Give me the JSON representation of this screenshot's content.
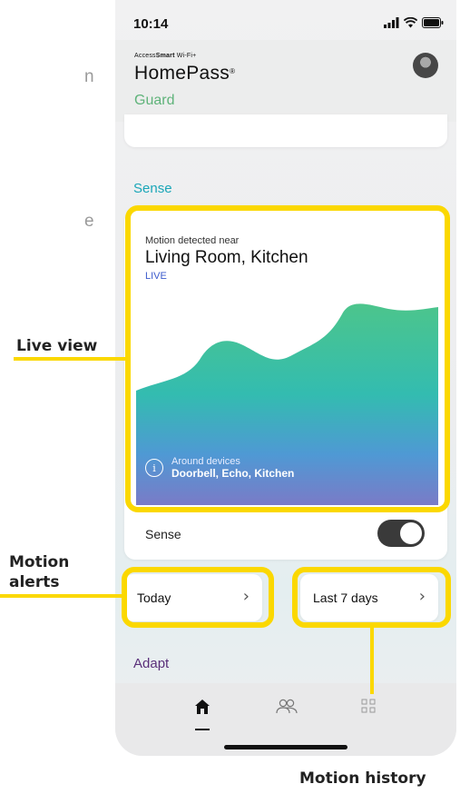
{
  "left_edge": {
    "char_top": "n",
    "char_bottom": "e"
  },
  "status_bar": {
    "time": "10:14"
  },
  "header": {
    "brand_prefix": "Access",
    "brand_bold": "Smart",
    "brand_suffix": " Wi-Fi+",
    "brand": "HomePass",
    "brand_mark": "®",
    "section": "Guard"
  },
  "sense": {
    "title": "Sense",
    "motion_label": "Motion detected near",
    "room": "Living Room, Kitchen",
    "live": "LIVE",
    "around_label": "Around devices",
    "around_devices": "Doorbell, Echo, Kitchen",
    "toggle_label": "Sense",
    "toggle_on": true
  },
  "motion_cards": [
    {
      "label": "Today"
    },
    {
      "label": "Last 7 days"
    }
  ],
  "adapt": {
    "title": "Adapt"
  },
  "nav": [
    {
      "icon": "home-icon",
      "active": true
    },
    {
      "icon": "people-icon",
      "active": false
    },
    {
      "icon": "grid-icon",
      "active": false
    }
  ],
  "callouts": {
    "live_view": "Live view",
    "motion_alerts": "Motion\nalerts",
    "motion_history": "Motion history"
  },
  "colors": {
    "highlight": "#fbd800",
    "guard": "#5fb37a",
    "sense": "#1aa6b8",
    "adapt": "#5a2f7a",
    "live": "#3c5bcc"
  }
}
